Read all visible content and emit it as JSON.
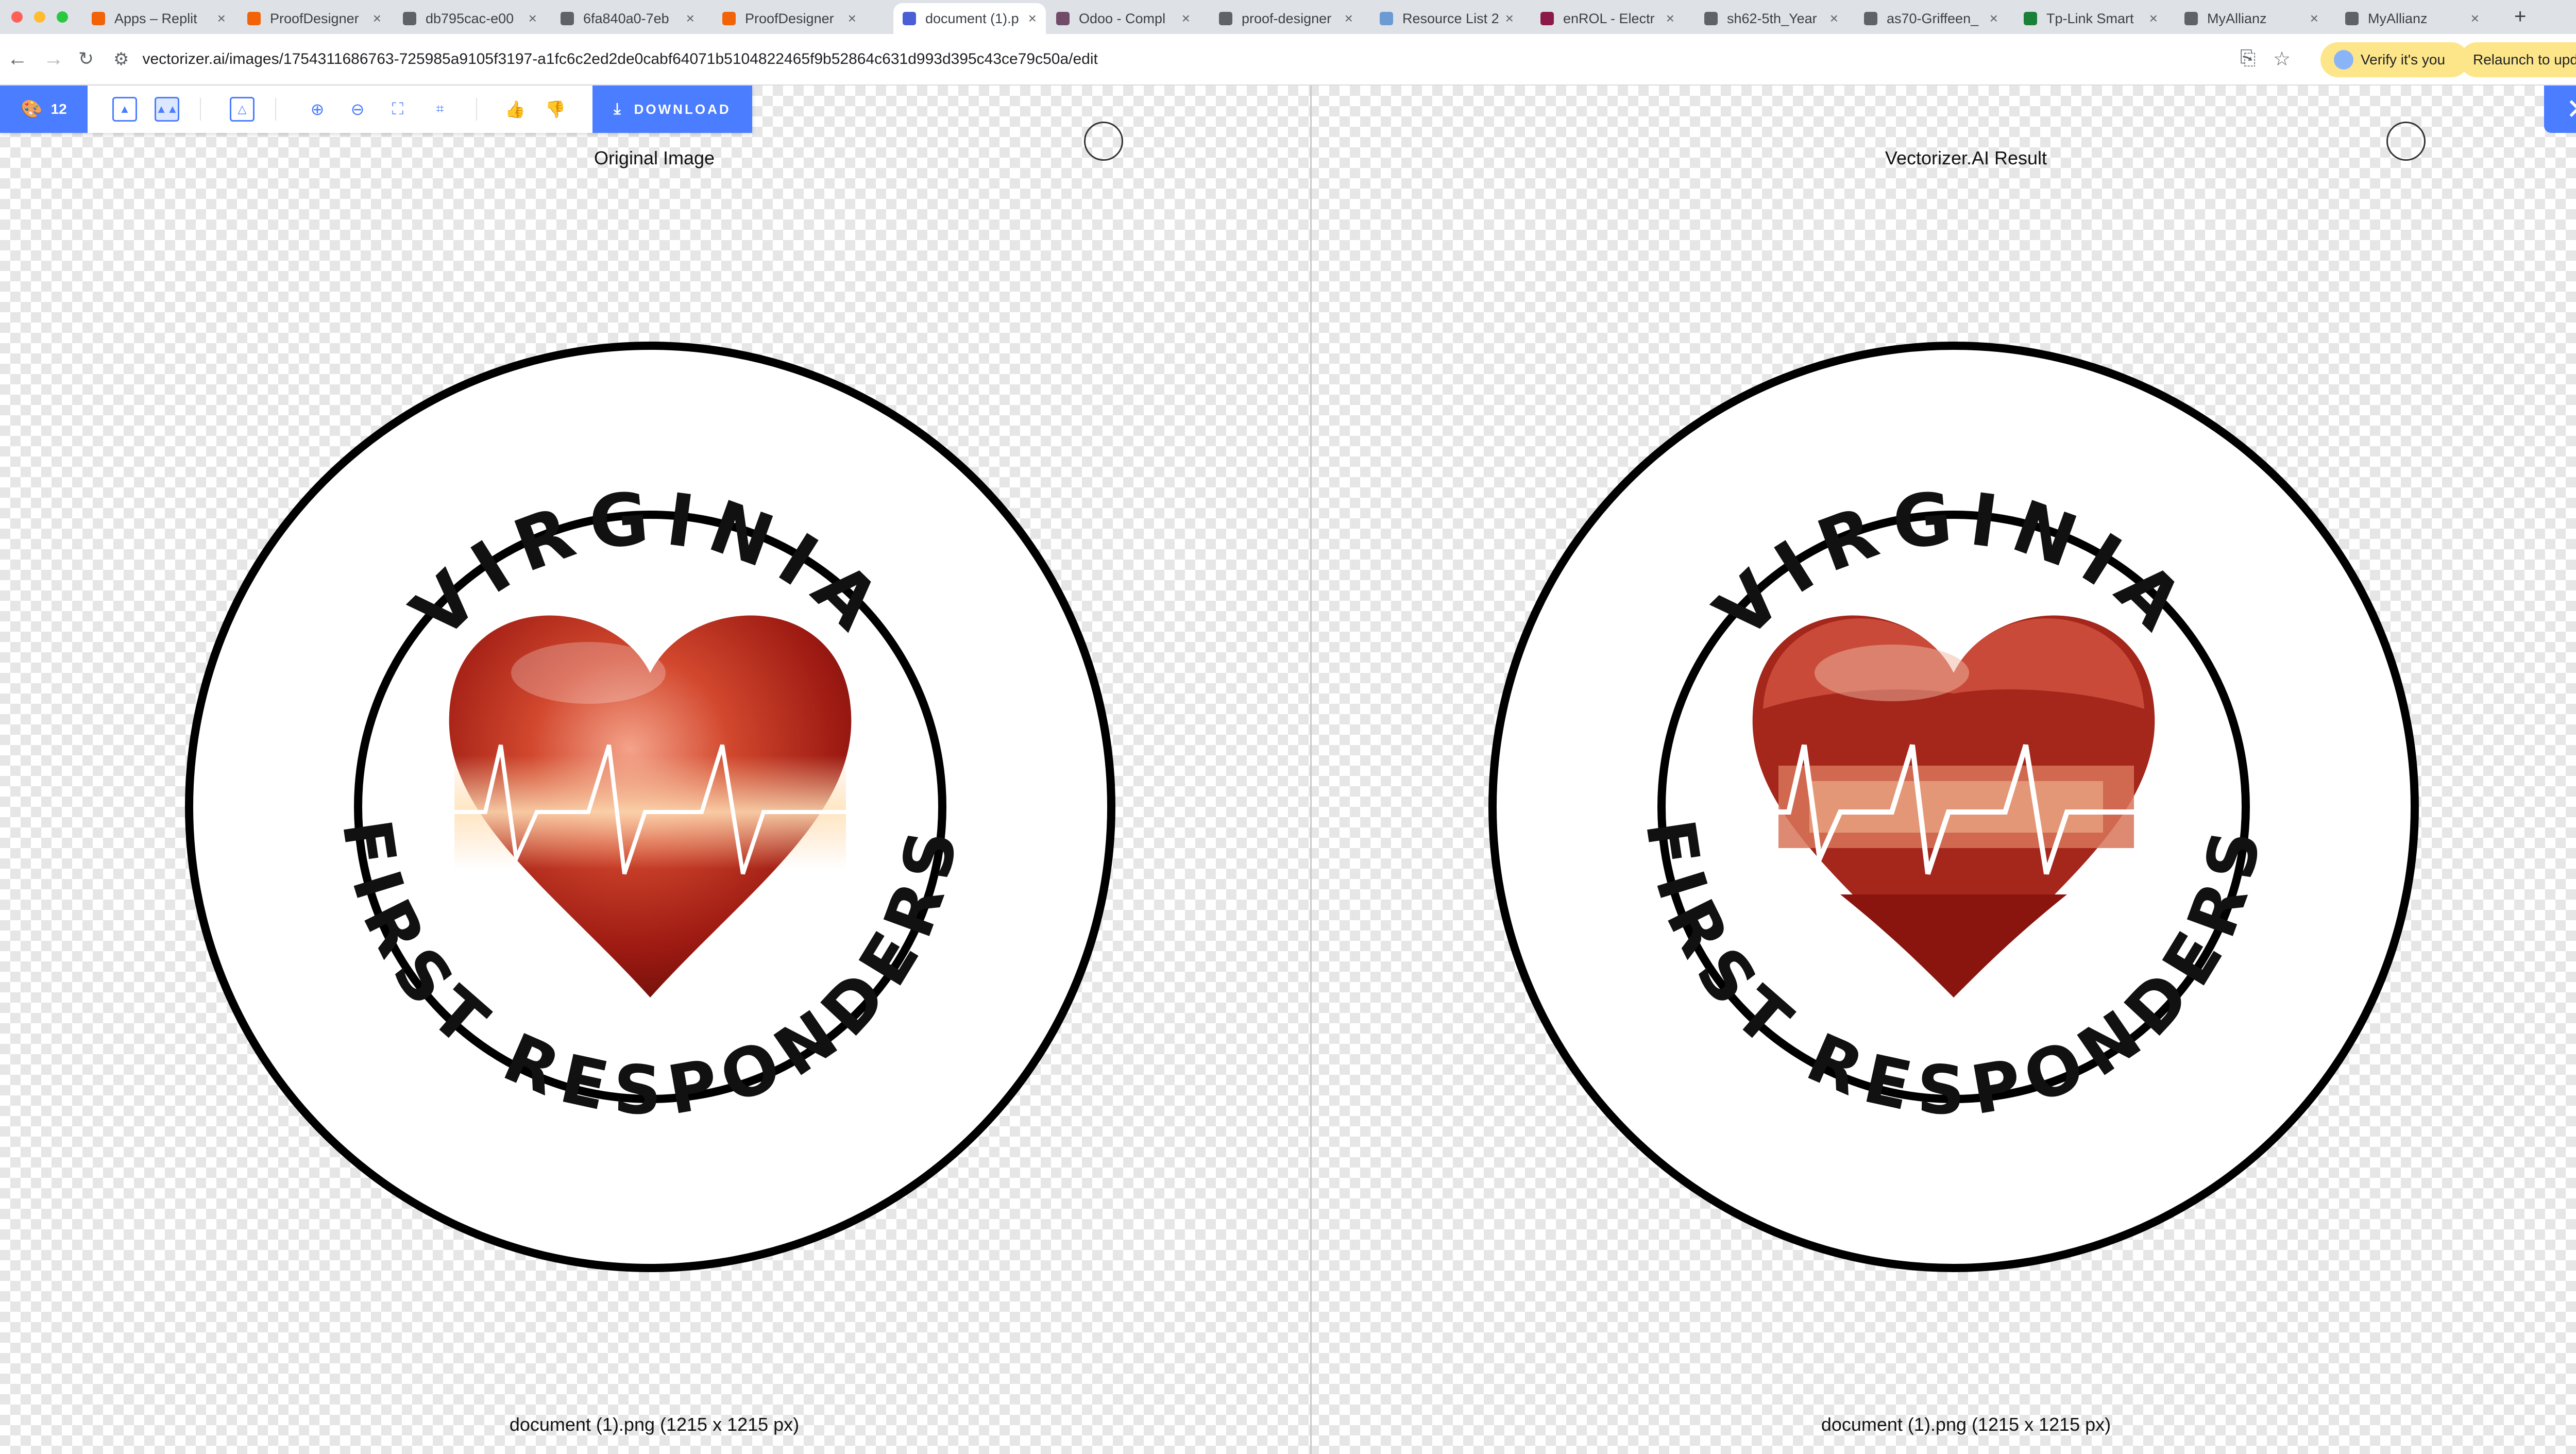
{
  "browser": {
    "tabs": [
      {
        "title": "Apps – Replit",
        "favicon": "replit-icon",
        "fav_color": "#f26207"
      },
      {
        "title": "ProofDesigner",
        "favicon": "replit-icon",
        "fav_color": "#f26207"
      },
      {
        "title": "db795cac-e00",
        "favicon": "globe-icon",
        "fav_color": "#5f6368"
      },
      {
        "title": "6fa840a0-7eb",
        "favicon": "globe-icon",
        "fav_color": "#5f6368"
      },
      {
        "title": "ProofDesigner",
        "favicon": "replit-icon",
        "fav_color": "#f26207"
      },
      {
        "title": "document (1).p",
        "favicon": "vectorizer-icon",
        "fav_color": "#4a5fd6",
        "active": true
      },
      {
        "title": "Odoo - Compl",
        "favicon": "odoo-icon",
        "fav_color": "#714b67"
      },
      {
        "title": "proof-designer",
        "favicon": "globe-icon",
        "fav_color": "#5f6368"
      },
      {
        "title": "Resource List 2",
        "favicon": "globe-icon",
        "fav_color": "#6b9bd2"
      },
      {
        "title": "enROL - Electr",
        "favicon": "enrol-icon",
        "fav_color": "#8b1a4a"
      },
      {
        "title": "sh62-5th_Year",
        "favicon": "globe-icon",
        "fav_color": "#5f6368"
      },
      {
        "title": "as70-Griffeen_",
        "favicon": "globe-icon",
        "fav_color": "#5f6368"
      },
      {
        "title": "Tp-Link Smart",
        "favicon": "tplink-icon",
        "fav_color": "#1a7f37"
      },
      {
        "title": "MyAllianz",
        "favicon": "globe-icon",
        "fav_color": "#5f6368"
      },
      {
        "title": "MyAllianz",
        "favicon": "globe-icon",
        "fav_color": "#5f6368"
      }
    ],
    "url": "vectorizer.ai/images/1754311686763-725985a9105f3197-a1fc6c2ed2de0cabf64071b5104822465f9b52864c631d993d395c43ce79c50a/edit",
    "verify_label": "Verify it's you",
    "relaunch_label": "Relaunch to update"
  },
  "app": {
    "credits": "12",
    "download_label": "DOWNLOAD",
    "left_panel": {
      "title": "Original Image",
      "caption": "document (1).png (1215 x 1215 px)"
    },
    "right_panel": {
      "title": "Vectorizer.AI Result",
      "caption": "document (1).png (1215 x 1215 px)"
    },
    "logo": {
      "top_text": "VIRGINIA",
      "bottom_text": "FIRST RESPONDERS"
    },
    "accent_color": "#4a7dff"
  }
}
